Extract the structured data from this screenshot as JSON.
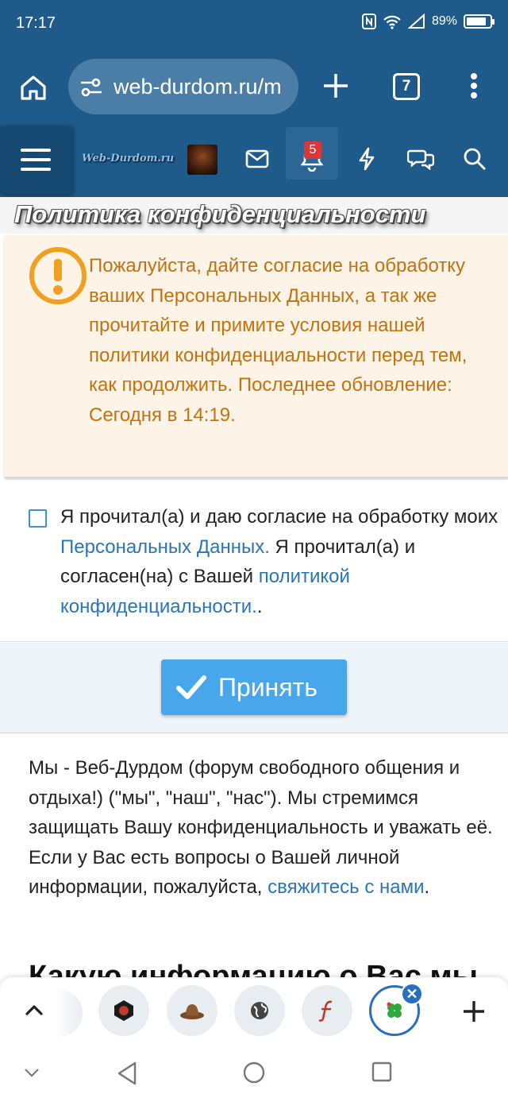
{
  "status_bar": {
    "time": "17:17",
    "battery": "89%",
    "battery_level": 0.89
  },
  "browser": {
    "url": "web-durdom.ru/m",
    "tab_count": "7"
  },
  "forum_nav": {
    "logo_text": "Web-Durdom.ru",
    "alerts_count": "5"
  },
  "page": {
    "title": "Политика конфиденциальности",
    "notice": "Пожалуйста, дайте согласие на обработку ваших Персональных Данных, а так же прочитайте и примите условия нашей политики конфиденциальности перед тем, как продолжить. Последнее обновление: Сегодня в 14:19.",
    "consent": {
      "part1": "Я прочитал(а) и даю согласие на обработку моих ",
      "link1": "Персональных Данных.",
      "part2": " Я прочитал(а) и согласен(на) с Вашей ",
      "link2": "политикой конфиденциальности.",
      "part3": "."
    },
    "accept_label": "Принять",
    "intro": {
      "text": "Мы - Веб-Дурдом (форум свободного общения и отдыха!) (\"мы\", \"наш\", \"нас\"). Мы стремимся защищать Вашу конфиденциальность и уважать её. Если у Вас есть вопросы о Вашей личной информации, пожалуйста, ",
      "link": "свяжитесь с нами",
      "end": "."
    },
    "next_heading": "Какую информацию о Вас мы"
  },
  "colors": {
    "header": "#1f5b8a",
    "notice_bg": "#fdf3e6",
    "notice_text": "#c2720e",
    "link": "#2a74b8",
    "accept_button": "#47a7ea"
  }
}
